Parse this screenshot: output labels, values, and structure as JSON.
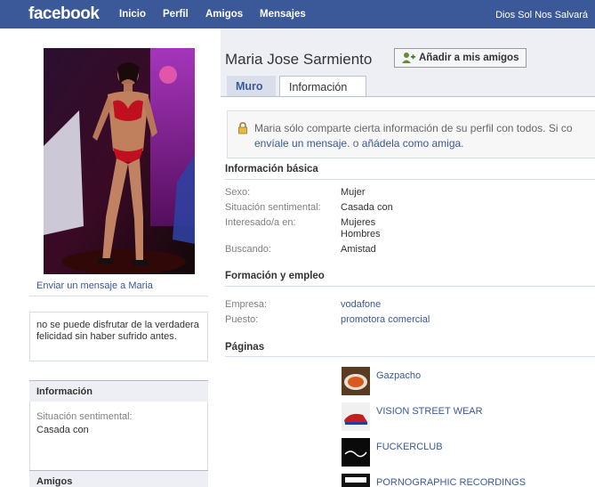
{
  "header": {
    "logo": "facebook",
    "nav": [
      "Inicio",
      "Perfil",
      "Amigos",
      "Mensajes"
    ],
    "user_name": "Dios Sol Nos Salvará"
  },
  "profile": {
    "name": "Maria Jose Sarmiento",
    "add_friend_label": "Añadir a mis amigos",
    "tabs": [
      "Muro",
      "Información"
    ],
    "send_message_link": "Enviar un mensaje a Maria"
  },
  "sidebar": {
    "quote": "no se puede disfrutar de la verdadera felicidad sin haber sufrido antes.",
    "info_header": "Información",
    "info_label": "Situación sentimental:",
    "info_value": "Casada con",
    "friends_header": "Amigos"
  },
  "privacy": {
    "text_start": "Maria sólo comparte cierta información de su perfil con todos. Si co",
    "link1": "envíale un mensaje",
    "middle": ". o ",
    "link2": "añádela como amiga",
    "end": "."
  },
  "basic_info": {
    "title": "Información básica",
    "rows": [
      {
        "label": "Sexo:",
        "value": "Mujer"
      },
      {
        "label": "Situación sentimental:",
        "value": "Casada con"
      },
      {
        "label": "Interesado/a en:",
        "value": "Mujeres",
        "value2": "Hombres"
      },
      {
        "label": "Buscando:",
        "value": "Amistad"
      }
    ]
  },
  "education_work": {
    "title": "Formación y empleo",
    "rows": [
      {
        "label": "Empresa:",
        "value": "vodafone"
      },
      {
        "label": "Puesto:",
        "value": "promotora comercial"
      }
    ]
  },
  "pages": {
    "title": "Páginas",
    "items": [
      {
        "name": "Gazpacho"
      },
      {
        "name": "VISION STREET WEAR"
      },
      {
        "name": "FUCKERCLUB"
      },
      {
        "name": "PORNOGRAPHIC RECORDINGS"
      }
    ]
  }
}
